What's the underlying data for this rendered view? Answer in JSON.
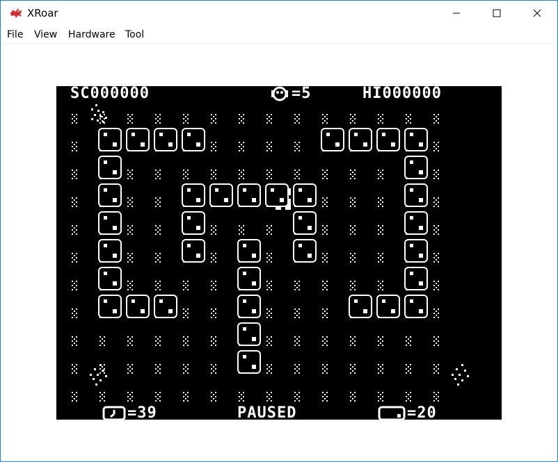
{
  "window": {
    "title": "XRoar",
    "minimize_glyph": "—",
    "maximize_glyph": "☐",
    "close_glyph": "✕"
  },
  "menu": {
    "items": [
      "File",
      "View",
      "Hardware",
      "Tool"
    ]
  },
  "game": {
    "score_text": "SC000000",
    "lives_text": "=5",
    "hiscore_text": "HI000000",
    "timer_text": "=39",
    "status_text": "PAUSED",
    "blocks_text": "=20"
  },
  "colors": {
    "screen_bg": "#000000",
    "foreground": "#ffffff",
    "window_border": "#1883d7",
    "close_icon_color": "#e81123"
  }
}
